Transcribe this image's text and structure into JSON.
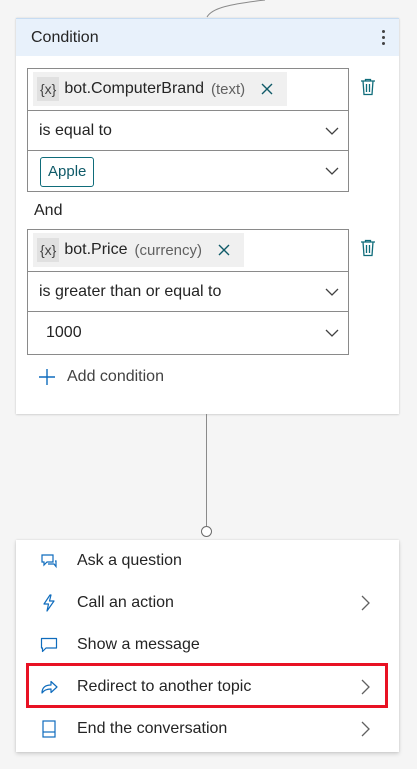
{
  "condition": {
    "title": "Condition",
    "groups": [
      {
        "variable_badge": "{x}",
        "variable_name": "bot.ComputerBrand",
        "variable_type": "(text)",
        "operator": "is equal to",
        "value": "Apple"
      },
      {
        "variable_badge": "{x}",
        "variable_name": "bot.Price",
        "variable_type": "(currency)",
        "operator": "is greater than or equal to",
        "value": "1000"
      }
    ],
    "and_label": "And",
    "add_condition_label": "Add condition"
  },
  "menu": {
    "items": [
      {
        "label": "Ask a question",
        "icon": "ask-question-icon",
        "has_submenu": false
      },
      {
        "label": "Call an action",
        "icon": "lightning-icon",
        "has_submenu": true
      },
      {
        "label": "Show a message",
        "icon": "message-icon",
        "has_submenu": false
      },
      {
        "label": "Redirect to another topic",
        "icon": "redirect-arrow-icon",
        "has_submenu": true,
        "highlighted": true
      },
      {
        "label": "End the conversation",
        "icon": "end-conversation-icon",
        "has_submenu": true
      }
    ]
  },
  "colors": {
    "header_bg": "#e8f1fb",
    "accent_teal": "#0f6c7a",
    "highlight_red": "#e81123",
    "icon_blue": "#0f6cbd"
  }
}
